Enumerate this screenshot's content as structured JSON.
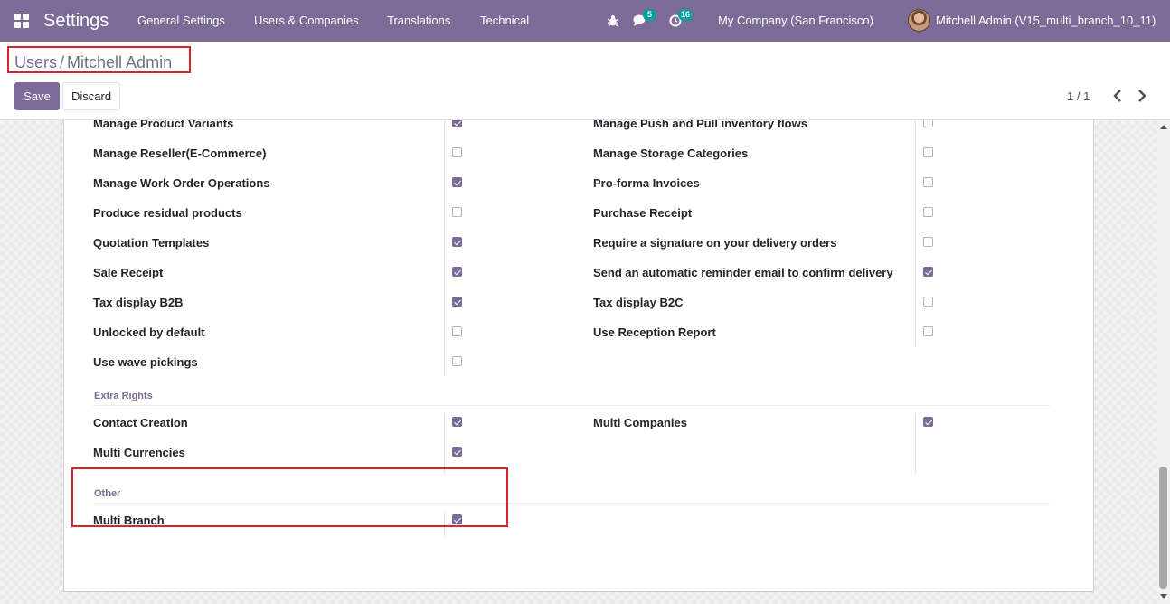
{
  "navbar": {
    "app_title": "Settings",
    "menu": [
      "General Settings",
      "Users & Companies",
      "Translations",
      "Technical"
    ],
    "icons": {
      "apps": "apps-grid-icon",
      "debug": "bug-icon",
      "messages": "chat-icon",
      "activities": "clock-icon"
    },
    "messages_badge": "5",
    "activities_badge": "16",
    "company": "My Company (San Francisco)",
    "user": "Mitchell Admin (V15_multi_branch_10_11)",
    "color": "#7c6b97",
    "badge_color": "#00a09d"
  },
  "breadcrumb": {
    "parent": "Users",
    "separator": "/",
    "current": "Mitchell Admin"
  },
  "actions": {
    "save": "Save",
    "discard": "Discard"
  },
  "pager": {
    "value": "1 / 1",
    "prev_icon": "chevron-left-icon",
    "next_icon": "chevron-right-icon"
  },
  "technical_rights": {
    "left": [
      {
        "label": "Manage Product Variants",
        "checked": true
      },
      {
        "label": "Manage Reseller(E-Commerce)",
        "checked": false
      },
      {
        "label": "Manage Work Order Operations",
        "checked": true
      },
      {
        "label": "Produce residual products",
        "checked": false
      },
      {
        "label": "Quotation Templates",
        "checked": true
      },
      {
        "label": "Sale Receipt",
        "checked": true
      },
      {
        "label": "Tax display B2B",
        "checked": true
      },
      {
        "label": "Unlocked by default",
        "checked": false
      },
      {
        "label": "Use wave pickings",
        "checked": false
      }
    ],
    "right": [
      {
        "label": "Manage Push and Pull inventory flows",
        "checked": false
      },
      {
        "label": "Manage Storage Categories",
        "checked": false
      },
      {
        "label": "Pro-forma Invoices",
        "checked": false
      },
      {
        "label": "Purchase Receipt",
        "checked": false
      },
      {
        "label": "Require a signature on your delivery orders",
        "checked": false
      },
      {
        "label": "Send an automatic reminder email to confirm delivery",
        "checked": true
      },
      {
        "label": "Tax display B2C",
        "checked": false
      },
      {
        "label": "Use Reception Report",
        "checked": false
      }
    ]
  },
  "extra_rights": {
    "title": "Extra Rights",
    "left": [
      {
        "label": "Contact Creation",
        "checked": true
      },
      {
        "label": "Multi Currencies",
        "checked": true
      }
    ],
    "right": [
      {
        "label": "Multi Companies",
        "checked": true
      }
    ]
  },
  "other": {
    "title": "Other",
    "left": [
      {
        "label": "Multi Branch",
        "checked": true
      }
    ]
  },
  "highlight_color": "#d9232e"
}
